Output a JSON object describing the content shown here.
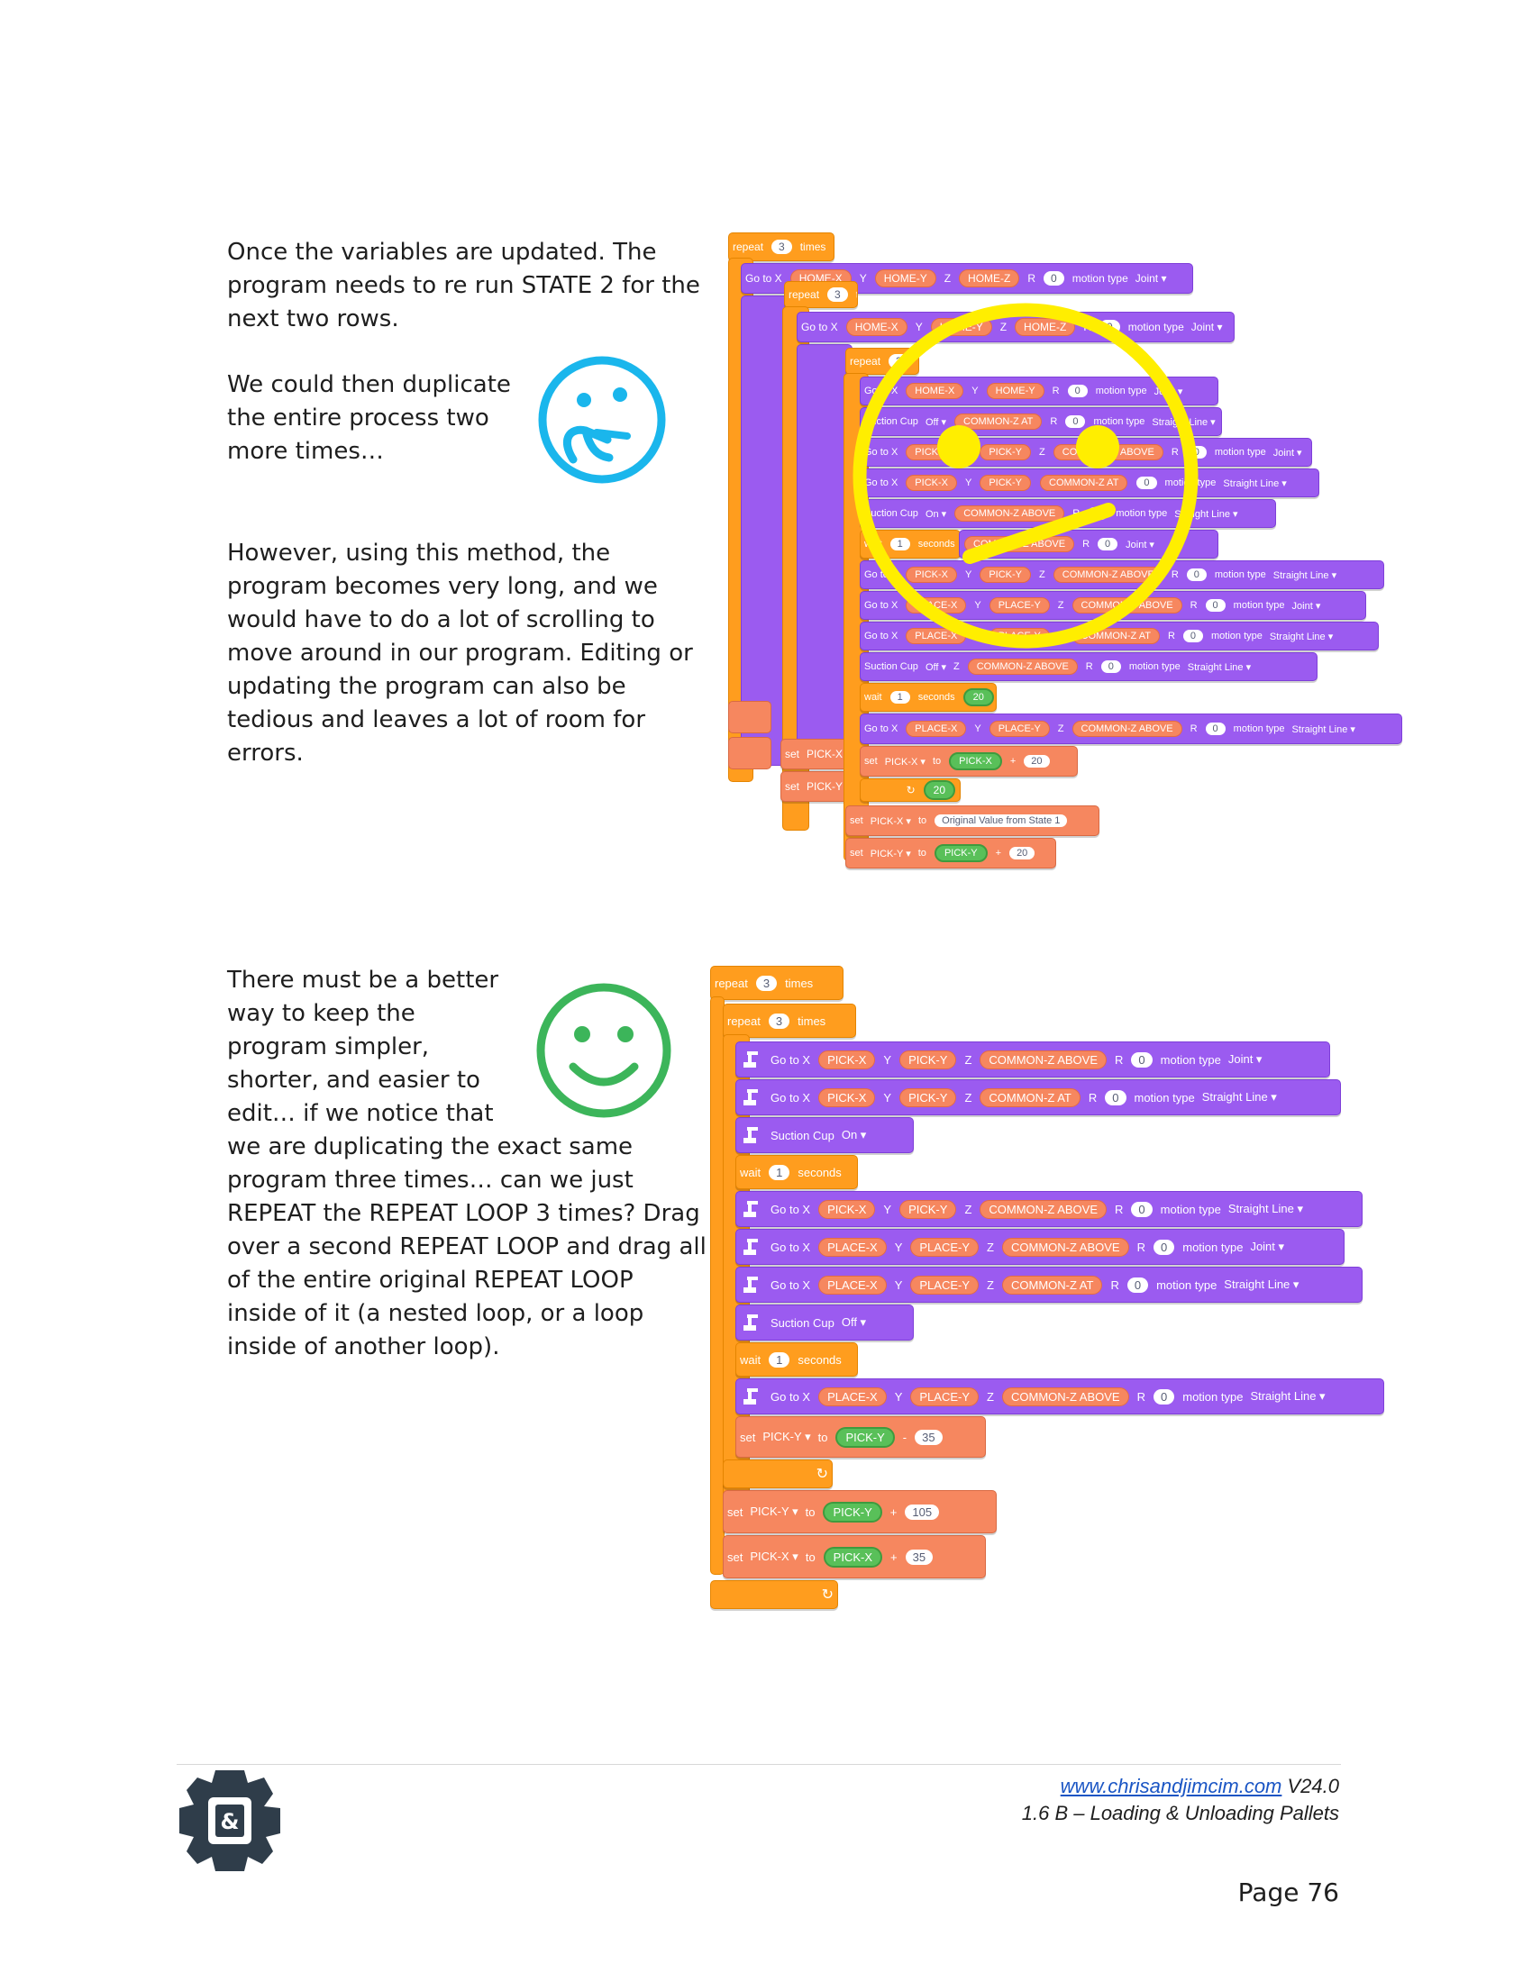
{
  "text": {
    "para1": "Once the variables are updated. The\nprogram needs to re run STATE 2 for the\nnext two rows.",
    "para2": "We could then duplicate\nthe entire process two\nmore times…",
    "para3": "However, using this method, the\nprogram becomes very long, and we\nwould have to do a lot of scrolling to\nmove around in our program. Editing or\nupdating the program can also be\ntedious and leaves a lot of room for\nerrors.",
    "para4": "There must be a better\nway to keep the\nprogram simpler,\nshorter, and easier to\nedit… if we notice that",
    "para5": "we are duplicating the exact same\nprogram three times… can we just\nREPEAT the REPEAT LOOP 3 times? Drag\nover a second REPEAT LOOP and drag all\nof the entire original REPEAT LOOP\ninside of it (a nested loop, or a loop\ninside of another loop)."
  },
  "icons": {
    "thinking": "thinking-face-emoji",
    "happy": "smiley-face-emoji",
    "meh": "yellow-skeptical-face",
    "robot": "robot-arm-icon",
    "logo": "gear-cj-logo"
  },
  "colors": {
    "orange": "#ff9d1e",
    "purple": "#9b5bf0",
    "salmon": "#f6875f",
    "green": "#59c059",
    "yellow": "#ffee00",
    "cyan": "#1ab6ec",
    "emojiGreen": "#3cb55a",
    "logo": "#2f3d4a"
  },
  "labels": {
    "repeat": "repeat",
    "times": "times",
    "three": "3",
    "goto": "Go to X",
    "y": "Y",
    "z": "Z",
    "r": "R",
    "zero": "0",
    "motion": "motion type",
    "joint": "Joint ▾",
    "straight": "Straight Line ▾",
    "suction": "Suction Cup",
    "on": "On ▾",
    "off": "Off ▾",
    "wait": "wait",
    "one": "1",
    "seconds": "seconds",
    "set": "set",
    "to": "to",
    "pickx": "PICK-X",
    "picky": "PICK-Y",
    "placex": "PLACE-X",
    "placey": "PLACE-Y",
    "above": "COMMON-Z ABOVE",
    "at": "COMMON-Z AT",
    "homex": "HOME-X",
    "homey": "HOME-Y",
    "homez": "HOME-Z",
    "pickydd": "PICK-Y ▾",
    "pickxdd": "PICK-X ▾",
    "minus": "-",
    "plus": "+",
    "v35": "35",
    "v105": "105",
    "v20": "20",
    "original": "Original Value from State 1",
    "loopArrow": "↻"
  },
  "footer": {
    "url": "www.chrisandjimcim.com",
    "version": " V24.0",
    "subtitle": "1.6 B – Loading & Unloading Pallets",
    "page": "Page 76"
  }
}
